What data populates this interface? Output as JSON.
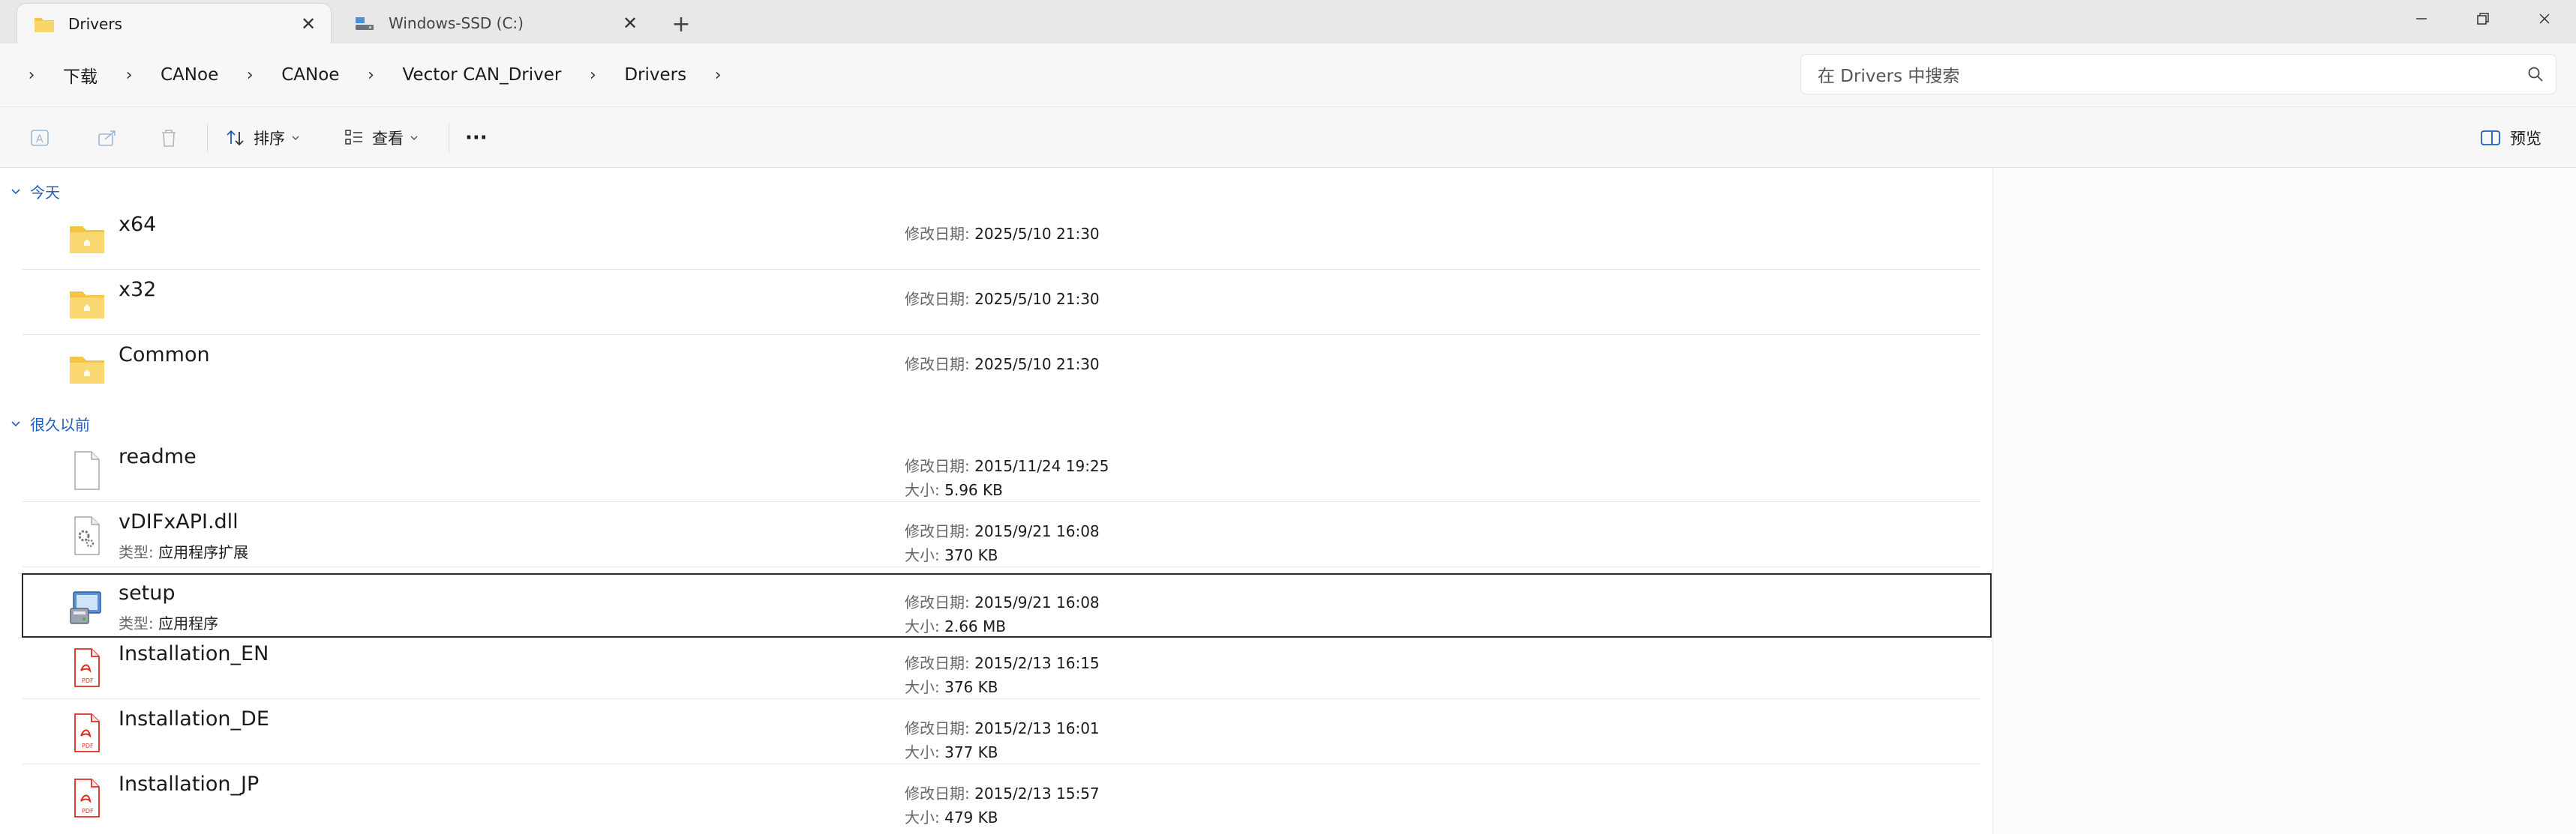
{
  "tabs": [
    {
      "label": "Drivers",
      "icon": "folder-icon",
      "active": true
    },
    {
      "label": "Windows-SSD (C:)",
      "icon": "drive-icon",
      "active": false
    }
  ],
  "new_tab_label": "+",
  "window_controls": {
    "minimize": "—",
    "maximize": "❐",
    "close": "✕"
  },
  "breadcrumb": [
    "下载",
    "CANoe",
    "CANoe",
    "Vector CAN_Driver",
    "Drivers"
  ],
  "search": {
    "placeholder": "在 Drivers 中搜索"
  },
  "toolbar": {
    "sort_label": "排序",
    "view_label": "查看",
    "more_label": "···",
    "preview_label": "预览"
  },
  "groups": [
    {
      "title": "今天",
      "items": [
        {
          "name": "x64",
          "type": "folder",
          "date_label": "修改日期:",
          "date": "2025/5/10 21:30"
        },
        {
          "name": "x32",
          "type": "folder",
          "date_label": "修改日期:",
          "date": "2025/5/10 21:30"
        },
        {
          "name": "Common",
          "type": "folder",
          "date_label": "修改日期:",
          "date": "2025/5/10 21:30"
        }
      ]
    },
    {
      "title": "很久以前",
      "items": [
        {
          "name": "readme",
          "type": "text",
          "date_label": "修改日期:",
          "date": "2015/11/24 19:25",
          "size_label": "大小:",
          "size": "5.96 KB"
        },
        {
          "name": "vDIFxAPI.dll",
          "type": "dll",
          "type_label": "类型:",
          "type_value": "应用程序扩展",
          "date_label": "修改日期:",
          "date": "2015/9/21 16:08",
          "size_label": "大小:",
          "size": "370 KB"
        },
        {
          "name": "setup",
          "type": "exe",
          "type_label": "类型:",
          "type_value": "应用程序",
          "date_label": "修改日期:",
          "date": "2015/9/21 16:08",
          "size_label": "大小:",
          "size": "2.66 MB",
          "selected": true
        },
        {
          "name": "Installation_EN",
          "type": "pdf",
          "date_label": "修改日期:",
          "date": "2015/2/13 16:15",
          "size_label": "大小:",
          "size": "376 KB"
        },
        {
          "name": "Installation_DE",
          "type": "pdf",
          "date_label": "修改日期:",
          "date": "2015/2/13 16:01",
          "size_label": "大小:",
          "size": "377 KB"
        },
        {
          "name": "Installation_JP",
          "type": "pdf",
          "date_label": "修改日期:",
          "date": "2015/2/13 15:57",
          "size_label": "大小:",
          "size": "479 KB"
        }
      ]
    }
  ],
  "colors": {
    "group_header": "#1f5fbf",
    "folder": "#f5c445",
    "pdf": "#d93025"
  }
}
